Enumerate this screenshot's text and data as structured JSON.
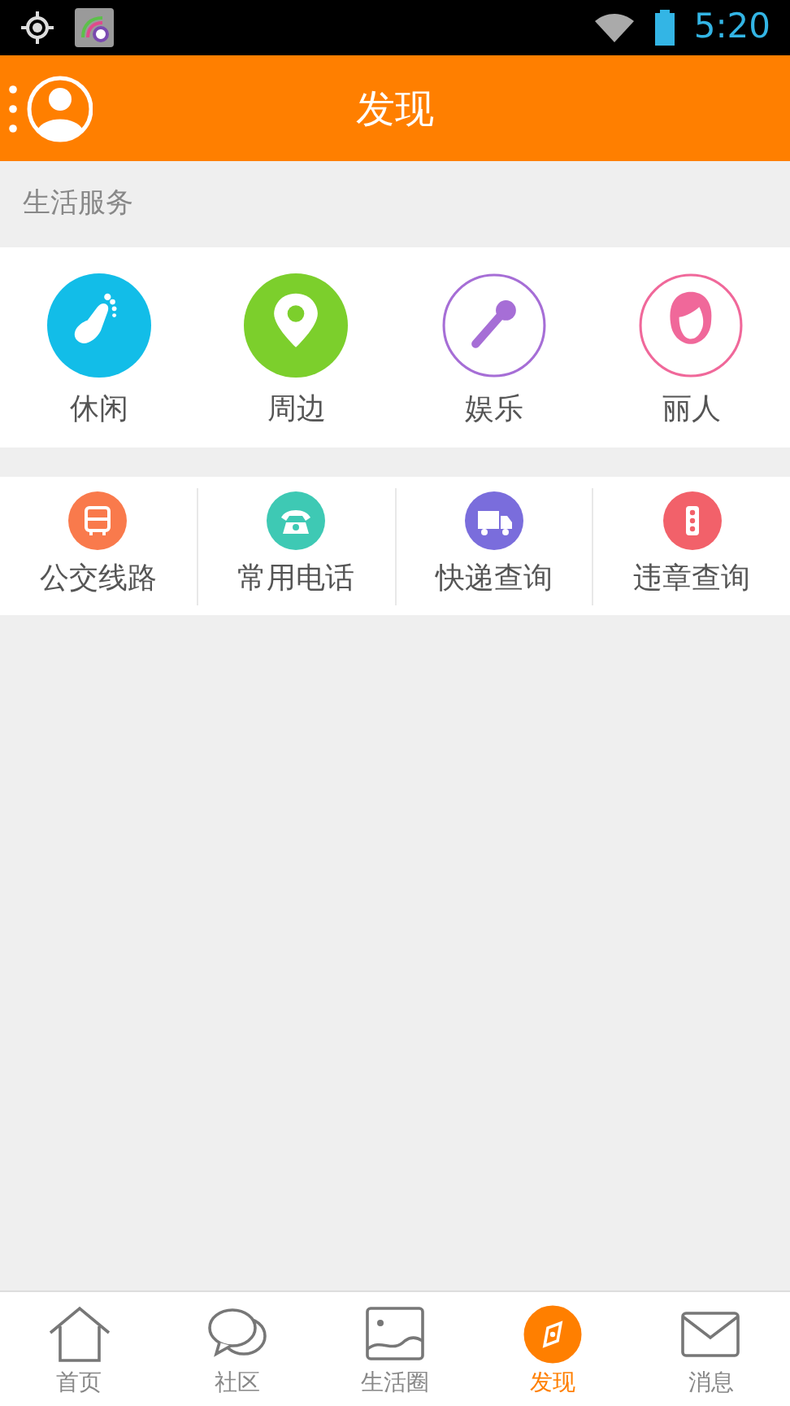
{
  "status_bar": {
    "time": "5:20"
  },
  "header": {
    "title": "发现"
  },
  "section": {
    "title": "生活服务"
  },
  "services": [
    {
      "label": "休闲",
      "kind": "foot",
      "color": "#12bde8"
    },
    {
      "label": "周边",
      "kind": "pin",
      "color": "#7ccf2c"
    },
    {
      "label": "娱乐",
      "kind": "mic",
      "color": "#a66ed6"
    },
    {
      "label": "丽人",
      "kind": "face",
      "color": "#f0689a"
    }
  ],
  "tools": [
    {
      "label": "公交线路",
      "kind": "bus",
      "color": "#f97a4c"
    },
    {
      "label": "常用电话",
      "kind": "phone",
      "color": "#3ec9b4"
    },
    {
      "label": "快递查询",
      "kind": "truck",
      "color": "#7a6ddc"
    },
    {
      "label": "违章查询",
      "kind": "light",
      "color": "#f2616a"
    }
  ],
  "tabs": [
    {
      "label": "首页",
      "kind": "home",
      "selected": false
    },
    {
      "label": "社区",
      "kind": "chat",
      "selected": false
    },
    {
      "label": "生活圈",
      "kind": "picture",
      "selected": false
    },
    {
      "label": "发现",
      "kind": "compass",
      "selected": true
    },
    {
      "label": "消息",
      "kind": "mail",
      "selected": false
    }
  ]
}
